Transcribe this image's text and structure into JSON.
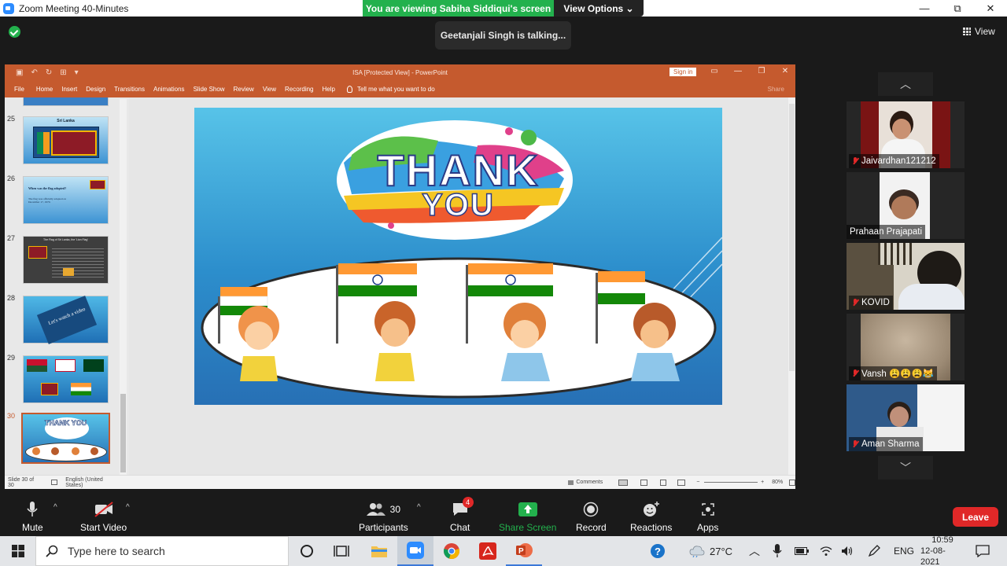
{
  "window": {
    "title": "Zoom Meeting 40-Minutes",
    "controls": [
      "—",
      "⧉",
      "✕"
    ]
  },
  "banner": {
    "viewing_text": "You are viewing Sabiha Siddiqui's screen",
    "view_options": "View Options ⌄"
  },
  "talking": "Geetanjali Singh is talking...",
  "view_button": "View",
  "powerpoint": {
    "doc_title": "ISA  [Protected View]  -  PowerPoint",
    "sign_in": "Sign in",
    "tabs": [
      "File",
      "Home",
      "Insert",
      "Design",
      "Transitions",
      "Animations",
      "Slide Show",
      "Review",
      "View",
      "Recording",
      "Help"
    ],
    "tell_me": "Tell me what you want to do",
    "share": "Share",
    "thumbnails": [
      {
        "num": "25",
        "title": "Sri Lanka"
      },
      {
        "num": "26",
        "title": "When was the flag adopted?",
        "body": "The flag was officially adopted on December 17, 1970."
      },
      {
        "num": "27",
        "title": "The Flag of Sri Lanka, the 'Lion Flag'"
      },
      {
        "num": "28",
        "title": "Let's watch a video"
      },
      {
        "num": "29",
        "title": ""
      },
      {
        "num": "30",
        "title": "THANK YOU"
      }
    ],
    "slide": {
      "line1": "THANK",
      "line2": "YOU"
    },
    "status": {
      "slide_count": "Slide 30 of 30",
      "language": "English (United States)",
      "comments": "Comments",
      "zoom": "80%"
    }
  },
  "participants_panel": [
    {
      "name": "Jaivardhan121212",
      "muted": true
    },
    {
      "name": "Prahaan Prajapati",
      "muted": false
    },
    {
      "name": "KOVID",
      "muted": true
    },
    {
      "name": "Vansh 😩😩😩😹",
      "muted": true
    },
    {
      "name": "Aman Sharma",
      "muted": true
    }
  ],
  "toolbar": {
    "mute": "Mute",
    "start_video": "Start Video",
    "participants": "Participants",
    "participants_count": "30",
    "chat": "Chat",
    "chat_badge": "4",
    "share_screen": "Share Screen",
    "record": "Record",
    "reactions": "Reactions",
    "apps": "Apps",
    "leave": "Leave"
  },
  "taskbar": {
    "search_placeholder": "Type here to search",
    "temperature": "27°C",
    "language": "ENG",
    "time": "10:59",
    "date": "12-08-2021"
  },
  "colors": {
    "zoom_green": "#23b14d",
    "ppt_orange": "#c55a2e",
    "leave_red": "#e02828"
  }
}
